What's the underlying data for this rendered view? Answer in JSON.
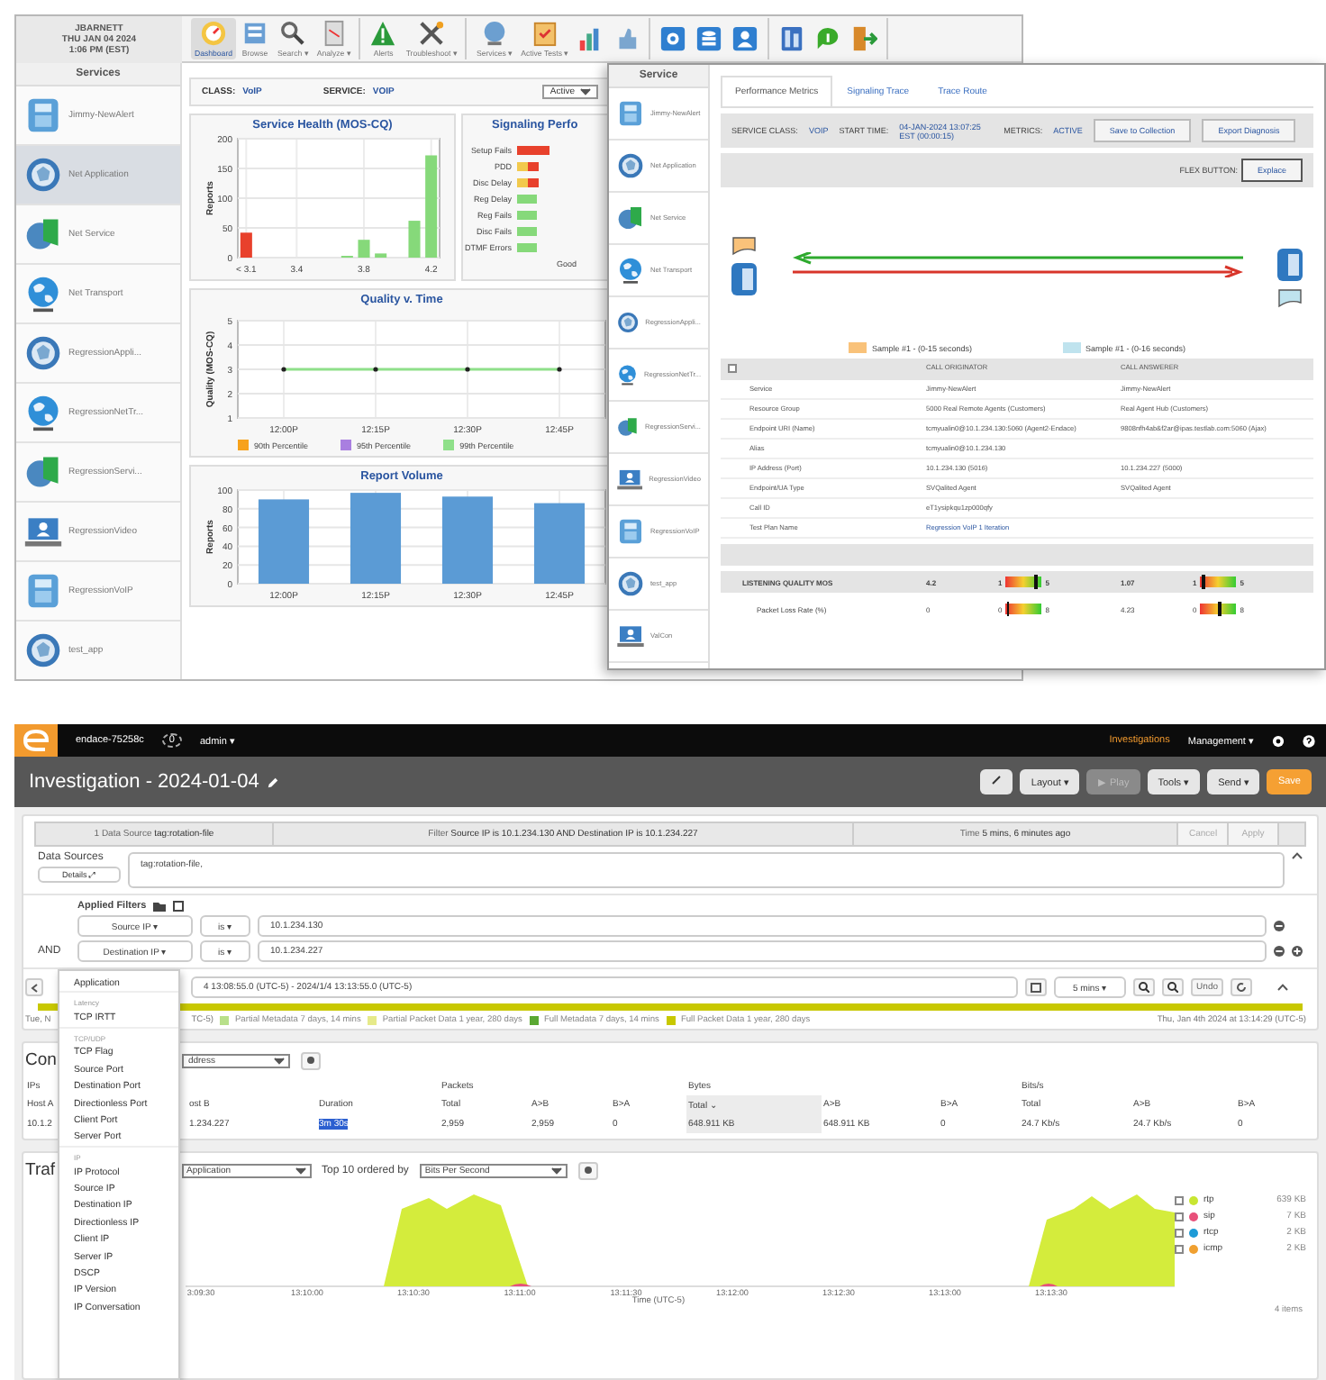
{
  "dashboard_window": {
    "user": "JBARNETT",
    "date": "THU JAN 04 2024",
    "time": "1:06 PM (EST)",
    "services_title": "Services",
    "services": [
      {
        "name": "Jimmy-NewAlert",
        "kind": "phone",
        "selected": false
      },
      {
        "name": "Net Application",
        "kind": "globe",
        "selected": true
      },
      {
        "name": "Net Service",
        "kind": "dns",
        "selected": false
      },
      {
        "name": "Net Transport",
        "kind": "earth",
        "selected": false
      },
      {
        "name": "RegressionAppli...",
        "kind": "globe",
        "selected": false
      },
      {
        "name": "RegressionNetTr...",
        "kind": "earth",
        "selected": false
      },
      {
        "name": "RegressionServi...",
        "kind": "dns",
        "selected": false
      },
      {
        "name": "RegressionVideo",
        "kind": "video",
        "selected": false
      },
      {
        "name": "RegressionVoIP",
        "kind": "phone",
        "selected": false
      },
      {
        "name": "test_app",
        "kind": "globe",
        "selected": false
      }
    ],
    "toolbar_groups": [
      {
        "items": [
          {
            "label": "Dashboard",
            "kind": "gauge",
            "selected": true
          },
          {
            "label": "Browse",
            "kind": "browse",
            "selected": false
          },
          {
            "label": "Search ▾",
            "kind": "search",
            "selected": false
          },
          {
            "label": "Analyze ▾",
            "kind": "analyze",
            "selected": false
          }
        ]
      },
      {
        "items": [
          {
            "label": "Alerts",
            "kind": "alert",
            "selected": false
          },
          {
            "label": "Troubleshoot ▾",
            "kind": "tools",
            "selected": false
          }
        ]
      },
      {
        "items": [
          {
            "label": "Services ▾",
            "kind": "services",
            "selected": false
          },
          {
            "label": "Active Tests ▾",
            "kind": "tests",
            "selected": false
          },
          {
            "kind": "report",
            "selected": false
          },
          {
            "kind": "thumb",
            "selected": false
          }
        ]
      },
      {
        "items": [
          {
            "kind": "gear",
            "selected": false
          },
          {
            "kind": "database",
            "selected": false
          },
          {
            "kind": "user",
            "selected": false
          }
        ]
      },
      {
        "items": [
          {
            "kind": "doc",
            "selected": false
          },
          {
            "kind": "info",
            "selected": false
          },
          {
            "kind": "exit",
            "selected": false
          }
        ]
      }
    ],
    "class_label": "CLASS:",
    "class_value": "VoIP",
    "service_label": "SERVICE:",
    "service_value": "VOIP",
    "status_select": "Active",
    "service_health": {
      "chart_data": {
        "type": "bar",
        "title": "Service Health (MOS-CQ)",
        "ylabel": "Reports",
        "x": [
          3.1,
          3.2,
          3.3,
          3.4,
          3.5,
          3.6,
          3.7,
          3.8,
          3.9,
          4.0,
          4.1,
          4.2
        ],
        "xlim": [
          3.05,
          4.25
        ],
        "xticks": [
          {
            "value": 3.1,
            "label": "< 3.1"
          },
          {
            "value": 3.4,
            "label": "3.4"
          },
          {
            "value": 3.8,
            "label": "3.8"
          },
          {
            "value": 4.2,
            "label": "4.2"
          }
        ],
        "ylim": [
          0,
          200
        ],
        "yticks": [
          0,
          50,
          100,
          150,
          200
        ],
        "grid": true,
        "series": [
          {
            "color": "#e8412c",
            "values": [
              42,
              null,
              null,
              null,
              null,
              null,
              null,
              null,
              null,
              null,
              null,
              null
            ]
          },
          {
            "color": "#86d97a",
            "values": [
              null,
              null,
              null,
              null,
              null,
              null,
              3,
              30,
              7,
              null,
              62,
              172
            ]
          }
        ]
      }
    },
    "signaling": {
      "title": "Signaling Perfo",
      "xlabel": "Good",
      "rows": [
        {
          "label": "Setup Fails",
          "kind": "bad"
        },
        {
          "label": "PDD",
          "kind": "warn"
        },
        {
          "label": "Disc Delay",
          "kind": "warn"
        },
        {
          "label": "Reg Delay",
          "kind": "good"
        },
        {
          "label": "Reg Fails",
          "kind": "good"
        },
        {
          "label": "Disc Fails",
          "kind": "good"
        },
        {
          "label": "DTMF Errors",
          "kind": "good"
        }
      ]
    },
    "quality": {
      "chart_data": {
        "type": "line",
        "title": "Quality v. Time",
        "ylabel": "Quality (MOS-CQ)",
        "categories": [
          "12:00P",
          "12:15P",
          "12:30P",
          "12:45P"
        ],
        "ylim": [
          1,
          5
        ],
        "yticks": [
          1,
          2,
          3,
          4,
          5
        ],
        "grid": true,
        "series": [
          {
            "name": "90th Percentile",
            "color": "#f7a21b",
            "values": [
              null,
              null,
              null,
              null
            ]
          },
          {
            "name": "95th Percentile",
            "color": "#a97fe0",
            "values": [
              null,
              null,
              null,
              null
            ]
          },
          {
            "name": "99th Percentile",
            "color": "#8fe08a",
            "values": [
              3,
              3,
              3,
              3
            ]
          }
        ]
      }
    },
    "report_volume": {
      "chart_data": {
        "type": "bar",
        "title": "Report Volume",
        "ylabel": "Reports",
        "categories": [
          "12:00P",
          "12:15P",
          "12:30P",
          "12:45P"
        ],
        "ylim": [
          0,
          100
        ],
        "yticks": [
          0,
          20,
          40,
          60,
          80,
          100
        ],
        "grid": true,
        "series": [
          {
            "color": "#5b9bd5",
            "values": [
              90,
              97,
              93,
              86
            ]
          }
        ]
      }
    }
  },
  "detail_window": {
    "services_title": "Service",
    "services": [
      {
        "name": "Jimmy-NewAlert",
        "kind": "phone"
      },
      {
        "name": "Net Application",
        "kind": "globe"
      },
      {
        "name": "Net Service",
        "kind": "dns"
      },
      {
        "name": "Net Transport",
        "kind": "earth"
      },
      {
        "name": "RegressionAppli...",
        "kind": "globe"
      },
      {
        "name": "RegressionNetTr...",
        "kind": "earth"
      },
      {
        "name": "RegressionServi...",
        "kind": "dns"
      },
      {
        "name": "RegressionVideo",
        "kind": "video"
      },
      {
        "name": "RegressionVoIP",
        "kind": "phone"
      },
      {
        "name": "test_app",
        "kind": "globe"
      },
      {
        "name": "ValCon",
        "kind": "video"
      }
    ],
    "tabs": [
      {
        "label": "Performance Metrics",
        "selected": true
      },
      {
        "label": "Signaling Trace",
        "selected": false
      },
      {
        "label": "Trace Route",
        "selected": false
      }
    ],
    "info": [
      {
        "label": "SERVICE CLASS:",
        "value": "VOIP"
      },
      {
        "label": "START TIME:",
        "value": "04-JAN-2024 13:07:25 EST (00:00:15)"
      },
      {
        "label": "METRICS:",
        "value": "ACTIVE"
      }
    ],
    "buttons": [
      "Save to Collection",
      "Export Diagnosis"
    ],
    "flex_label": "FLEX BUTTON:",
    "flex_button": "Explace",
    "legend": [
      {
        "label": "Sample #1 - (0-15 seconds)",
        "color": "#f9c27a"
      },
      {
        "label": "Sample #1 - (0-16 seconds)",
        "color": "#bfe3ee"
      }
    ],
    "table": {
      "columns": [
        "CALL ORIGINATOR",
        "CALL ANSWERER"
      ],
      "rows": [
        {
          "name": "Service",
          "originator": "Jimmy-NewAlert",
          "answerer": "Jimmy-NewAlert"
        },
        {
          "name": "Resource Group",
          "originator": "5000 Real Remote Agents (Customers)",
          "answerer": "Real Agent Hub (Customers)"
        },
        {
          "name": "Endpoint URI (Name)",
          "originator": "tcmyualin0@10.1.234.130:5060 (Agent2-Endace)",
          "answerer": "9808nfh4ab&f2ar@ipas.testlab.com:5060 (Ajax)"
        },
        {
          "name": "Alias",
          "originator": "tcmyualin0@10.1.234.130"
        },
        {
          "name": "IP Address (Port)",
          "originator": "10.1.234.130 (5016)",
          "answerer": "10.1.234.227 (5000)"
        },
        {
          "name": "Endpoint/UA Type",
          "originator": "SVQalited Agent",
          "answerer": "SVQalited Agent"
        },
        {
          "name": "Call ID",
          "originator": "eT1ysipkqu1zp000qfy"
        },
        {
          "name": "Test Plan Name",
          "originator": "Regression VoIP 1 Iteration"
        }
      ]
    },
    "metrics": [
      {
        "name": "LISTENING QUALITY MOS",
        "kind": "header",
        "originator": {
          "value": "4.2",
          "min": "1",
          "max": "5",
          "level": 0.8
        },
        "answerer": {
          "value": "1.07",
          "min": "1",
          "max": "5",
          "level": 0.05
        }
      },
      {
        "name": "Packet Loss Rate (%)",
        "kind": "row",
        "originator": {
          "value": "0",
          "min": "0",
          "max": "8",
          "level": 0.02
        },
        "answerer": {
          "value": "4.23",
          "min": "0",
          "max": "8",
          "level": 0.5
        }
      }
    ]
  },
  "investigation": {
    "host": "endace-75258c",
    "badge": "0",
    "user": "admin ▾",
    "nav": [
      {
        "label": "Investigations",
        "selected": true
      },
      {
        "label": "Management ▾",
        "selected": false
      }
    ],
    "title": "Investigation - 2024-01-04",
    "actions": [
      {
        "label": "Layout ▾",
        "disabled": false
      },
      {
        "label": "▶ Play",
        "disabled": true
      },
      {
        "label": "Tools ▾",
        "disabled": false
      },
      {
        "label": "Send ▾",
        "disabled": false
      }
    ],
    "save": "Save",
    "summary": [
      "1 Data Source **tag:rotation-file**",
      "Filter **Source IP is 10.1.234.130 AND Destination IP is 10.1.234.227**",
      "Time **5 mins, 6 minutes ago**"
    ],
    "summary_buttons": [
      "Cancel",
      "Apply"
    ],
    "data_sources_label": "Data Sources",
    "details": "Details ⤢",
    "data_sources_value": "tag:rotation-file,",
    "filters_label": "Applied Filters",
    "filters": [
      {
        "field": "Source IP ▾",
        "op": "is ▾",
        "value": "10.1.234.130",
        "add": false
      },
      {
        "joiner": "AND",
        "field": "Destination IP ▾",
        "op": "is ▾",
        "value": "10.1.234.227",
        "add": true
      }
    ],
    "menu": [
      {
        "label": "Application",
        "kind": "item"
      },
      {
        "label": "Latency",
        "kind": "header"
      },
      {
        "label": "TCP IRTT",
        "kind": "item"
      },
      {
        "label": "TCP/UDP",
        "kind": "header"
      },
      {
        "label": "TCP Flag",
        "kind": "item"
      },
      {
        "label": "Source Port",
        "kind": "item"
      },
      {
        "label": "Destination Port",
        "kind": "item"
      },
      {
        "label": "Directionless Port",
        "kind": "item"
      },
      {
        "label": "Client Port",
        "kind": "item"
      },
      {
        "label": "Server Port",
        "kind": "item"
      },
      {
        "label": "IP",
        "kind": "header"
      },
      {
        "label": "IP Protocol",
        "kind": "item"
      },
      {
        "label": "Source IP",
        "kind": "item"
      },
      {
        "label": "Destination IP",
        "kind": "item"
      },
      {
        "label": "Directionless IP",
        "kind": "item"
      },
      {
        "label": "Client IP",
        "kind": "item"
      },
      {
        "label": "Server IP",
        "kind": "item"
      },
      {
        "label": "DSCP",
        "kind": "item"
      },
      {
        "label": "IP Version",
        "kind": "item"
      },
      {
        "label": "IP Conversation",
        "kind": "item"
      }
    ],
    "time_range": "4 13:08:55.0 (UTC-5) - 2024/1/4 13:13:55.0 (UTC-5)",
    "span": "5 mins ▾",
    "undo": "Undo",
    "timeline_left": "Tue, N",
    "timeline_mid": "TC-5)",
    "timeline_legend": [
      {
        "label": "Partial Metadata 7 days, 14 mins",
        "color": "#b8e08a"
      },
      {
        "label": "Partial Packet Data 1 year, 280 days",
        "color": "#e6ea8a"
      },
      {
        "label": "Full Metadata 7 days, 14 mins",
        "color": "#5aa832"
      },
      {
        "label": "Full Packet Data 1 year, 280 days",
        "color": "#c8c800"
      }
    ],
    "timeline_right": "Thu, Jan 4th 2024 at 13:14:29 (UTC-5)",
    "conversations": {
      "title": "Con",
      "select": "ddress",
      "groups": [
        "Packets",
        "Bytes",
        "Bits/s"
      ],
      "left_labels": [
        "IPs",
        "Host A"
      ],
      "columns": [
        "ost B",
        "Duration",
        "Total",
        "A>B",
        "B>A",
        "Total ⌄",
        "A>B",
        "B>A",
        "Total",
        "A>B",
        "B>A"
      ],
      "row": [
        "10.1.2",
        "1.234.227",
        "3m 30s",
        "2,959",
        "2,959",
        "0",
        "648.911 KB",
        "648.911 KB",
        "0",
        "24.7 Kb/s",
        "24.7 Kb/s",
        "0"
      ]
    },
    "traffic": {
      "title": "Traf",
      "select": "Application",
      "ordered_label": "Top 10 ordered by",
      "order_select": "Bits Per Second",
      "xticks": [
        "3:09:30",
        "13:10:00",
        "13:10:30",
        "13:11:00",
        "13:11:30",
        "13:12:00",
        "13:12:30",
        "13:13:00",
        "13:13:30"
      ],
      "xlabel": "Time (UTC-5)",
      "legend": [
        {
          "name": "rtp",
          "value": "639 KB",
          "color": "#c8e632",
          "checked": false
        },
        {
          "name": "sip",
          "value": "7 KB",
          "color": "#e8507a",
          "checked": false
        },
        {
          "name": "rtcp",
          "value": "2 KB",
          "color": "#1e9bd7",
          "checked": false
        },
        {
          "name": "icmp",
          "value": "2 KB",
          "color": "#f0a030",
          "checked": false
        }
      ],
      "count": "4 items"
    }
  }
}
